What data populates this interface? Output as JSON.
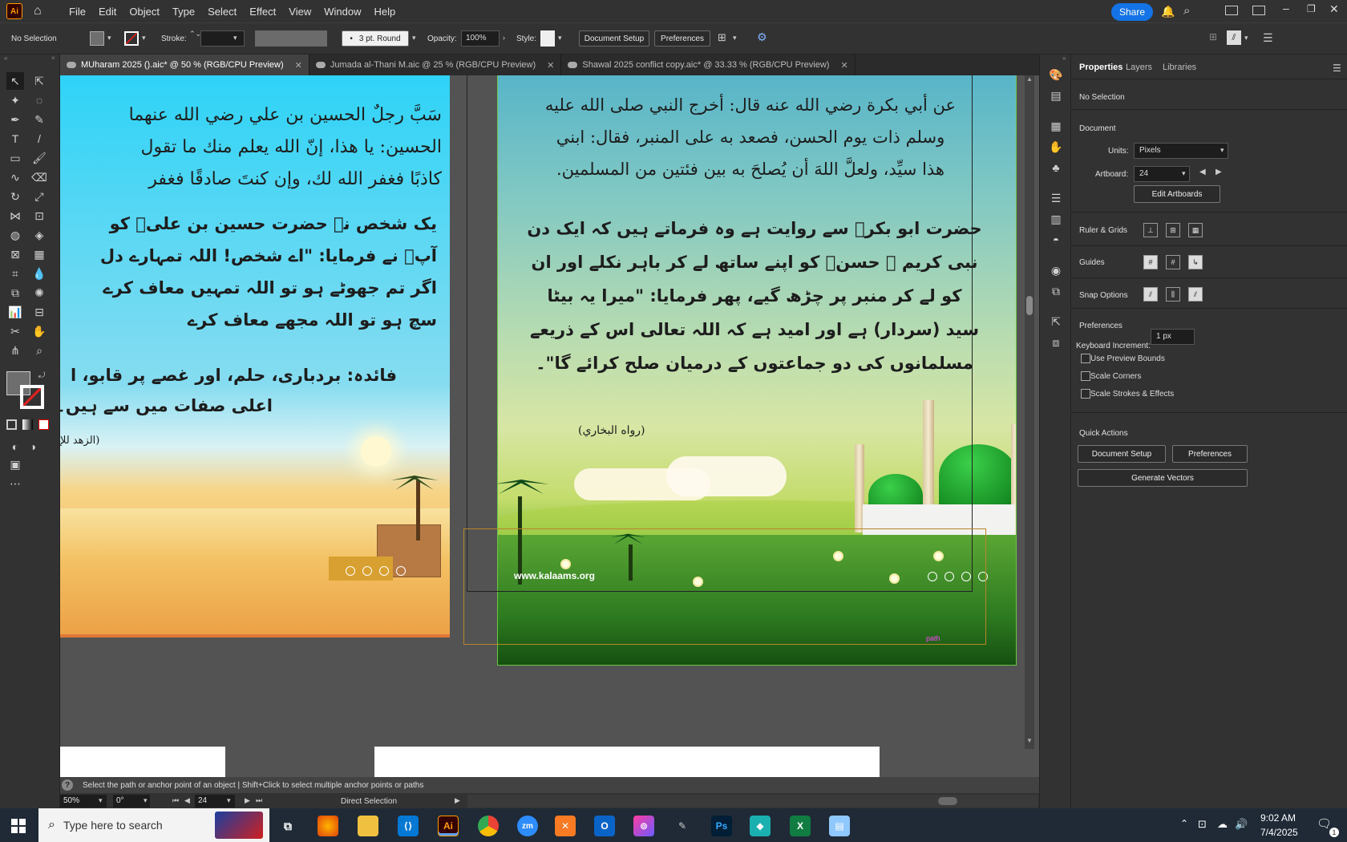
{
  "menubar": {
    "logo": "Ai",
    "items": [
      "File",
      "Edit",
      "Object",
      "Type",
      "Select",
      "Effect",
      "View",
      "Window",
      "Help"
    ],
    "share": "Share"
  },
  "control": {
    "selection": "No Selection",
    "stroke_label": "Stroke:",
    "brush": "3 pt. Round",
    "opacity_label": "Opacity:",
    "opacity_value": "100%",
    "style_label": "Style:",
    "doc_setup": "Document Setup",
    "preferences": "Preferences"
  },
  "tabs": [
    {
      "label": "MUharam 2025 ().aic* @ 50 % (RGB/CPU Preview)",
      "active": true
    },
    {
      "label": "Jumada al-Thani M.aic @ 25 % (RGB/CPU Preview)",
      "active": false
    },
    {
      "label": "Shawal 2025 conflict copy.aic* @ 33.33 % (RGB/CPU Preview)",
      "active": false
    }
  ],
  "art1": {
    "arabic": [
      "سَبَّ رجلٌ الحسين بن علي رضي الله عنهما",
      "الحسين: يا هذا، إنّ الله يعلم منك ما تقول",
      "كاذبًا فغفر الله لك، وإن كنتَ صادقًا فغفر"
    ],
    "urdu": [
      "یک شخص نے حضرت حسین بن علیؓ کو",
      "آپؓ نے فرمایا: \"اے شخص! اللہ تمہارے دل",
      "اگر تم جھوٹے ہو تو اللہ تمہیں معاف کرے",
      "سچ ہو تو اللہ مجھے معاف کرے"
    ],
    "benefit": [
      "فائدہ: بردباری، حلم، اور غصے پر قابو، ا",
      "اعلی صفات میں سے ہیں۔"
    ],
    "source": "(الزهد للإ"
  },
  "art2": {
    "arabic": [
      "عن أبي بكرة رضي الله عنه قال: أخرج النبي صلى الله عليه",
      "وسلم ذات يوم الحسن، فصعد به على المنبر، فقال: ابني",
      "هذا سيِّد، ولعلَّ اللهَ أن يُصلحَ به بين فئتين من المسلمين."
    ],
    "urdu": [
      "حضرت ابو بکرؓ سے روایت ہے وہ فرماتے ہیں کہ ایک دن",
      "نبی کریم ﷺ حسنؓ کو اپنے ساتھ لے کر باہر نکلے اور ان",
      "کو لے کر منبر پر چڑھ گیے، پھر فرمایا: \"میرا یہ بیٹا",
      "سید (سردار) ہے اور امید ہے کہ اللہ تعالی اس کے ذریعے",
      "مسلمانوں کی دو جماعتوں کے درمیان صلح کرائے گا\"۔"
    ],
    "source": "(رواه البخاري)",
    "website": "www.kalaams.org",
    "path_label": "path"
  },
  "props": {
    "tabs": [
      "Properties",
      "Layers",
      "Libraries"
    ],
    "selection": "No Selection",
    "document": "Document",
    "units_label": "Units:",
    "units_value": "Pixels",
    "artboard_label": "Artboard:",
    "artboard_value": "24",
    "edit_artboards": "Edit Artboards",
    "ruler_grids": "Ruler & Grids",
    "guides": "Guides",
    "snap_options": "Snap Options",
    "preferences": "Preferences",
    "kbd_label": "Keyboard Increment:",
    "kbd_value": "1 px",
    "checks": [
      "Use Preview Bounds",
      "Scale Corners",
      "Scale Strokes & Effects"
    ],
    "quick_actions": "Quick Actions",
    "qa_doc_setup": "Document Setup",
    "qa_preferences": "Preferences",
    "qa_generate": "Generate Vectors"
  },
  "status": {
    "hint": "Select the path or anchor point of an object  |  Shift+Click to select multiple anchor points or paths",
    "zoom": "50%",
    "rotation": "0°",
    "artboard": "24",
    "tool": "Direct Selection"
  },
  "taskbar": {
    "search": "Type here to search",
    "time": "9:02 AM",
    "date": "7/4/2025",
    "notif": "1"
  }
}
